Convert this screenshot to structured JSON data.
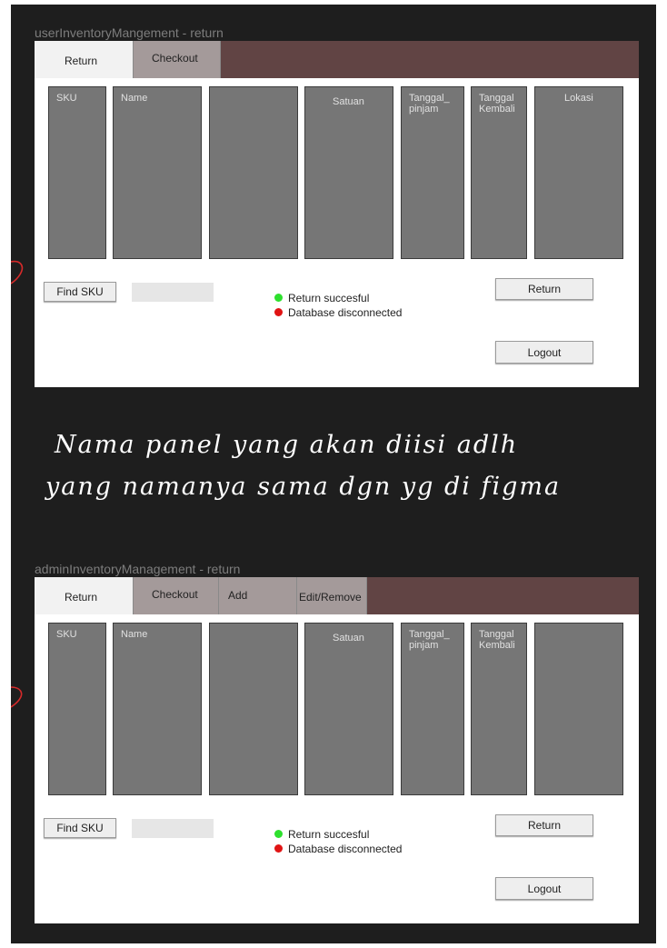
{
  "frames": [
    {
      "title": "userInventoryMangement - return",
      "tabs": [
        "Return",
        "Checkout"
      ],
      "columns": [
        "SKU",
        "Name",
        "",
        "Satuan",
        "Tanggal_\npinjam",
        "Tanggal\nKembali",
        "Lokasi"
      ],
      "find_button": "Find SKU",
      "status_success": "Return succesful",
      "status_error": "Database disconnected",
      "return_button": "Return",
      "logout_button": "Logout"
    },
    {
      "title": "adminInventoryManagement - return",
      "tabs": [
        "Return",
        "Checkout",
        "Add",
        "Edit/Remove"
      ],
      "columns": [
        "SKU",
        "Name",
        "",
        "Satuan",
        "Tanggal_\npinjam",
        "Tanggal\nKembali",
        ""
      ],
      "find_button": "Find SKU",
      "status_success": "Return succesful",
      "status_error": "Database disconnected",
      "return_button": "Return",
      "logout_button": "Logout"
    }
  ],
  "note": {
    "line1": "Nama panel yang akan diisi adlh",
    "line2": "yang namanya sama dgn yg di figma"
  },
  "colors": {
    "canvas": "#1e1e1e",
    "tabbar": "#614444",
    "column": "#767676",
    "status_success": "#2ee02e",
    "status_error": "#e01414",
    "annotation": "#d62a2a"
  }
}
